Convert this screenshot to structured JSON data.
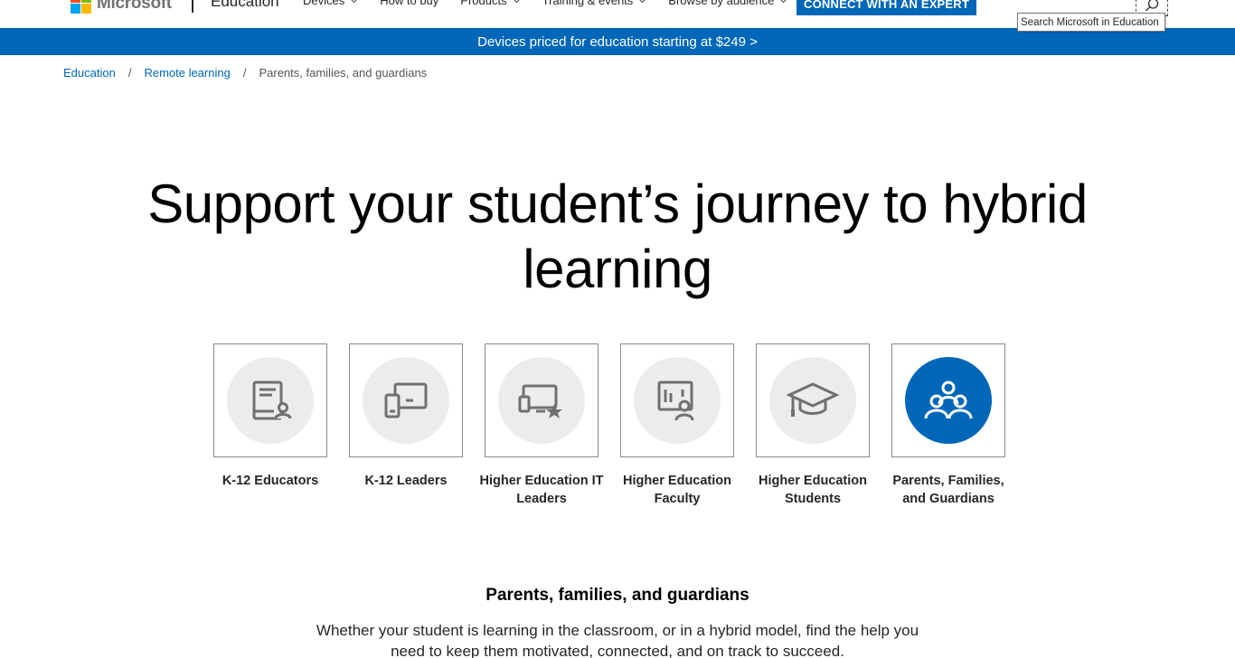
{
  "header": {
    "logo_text": "Microsoft",
    "brand": "Education",
    "nav": [
      {
        "label": "Devices",
        "has_dropdown": true
      },
      {
        "label": "How to buy",
        "has_dropdown": false
      },
      {
        "label": "Products",
        "has_dropdown": true
      },
      {
        "label": "Training & events",
        "has_dropdown": true
      },
      {
        "label": "Browse by audience",
        "has_dropdown": true
      }
    ],
    "cta_label": "CONNECT WITH AN EXPERT",
    "search_tooltip": "Search Microsoft in Education"
  },
  "promo": {
    "text": "Devices priced for education starting at $249 >"
  },
  "breadcrumb": {
    "items": [
      "Education",
      "Remote learning"
    ],
    "current": "Parents, families, and guardians",
    "separator": "/"
  },
  "hero": {
    "title": "Support your student’s journey to hybrid learning"
  },
  "audiences": [
    {
      "label": "K-12 Educators",
      "icon": "book-person-icon",
      "active": false
    },
    {
      "label": "K-12 Leaders",
      "icon": "devices-icon",
      "active": false
    },
    {
      "label": "Higher Education IT Leaders",
      "icon": "device-star-icon",
      "active": false
    },
    {
      "label": "Higher Education Faculty",
      "icon": "chart-person-icon",
      "active": false
    },
    {
      "label": "Higher Education Students",
      "icon": "graduation-cap-icon",
      "active": false
    },
    {
      "label": "Parents, Families, and Guardians",
      "icon": "family-icon",
      "active": true
    }
  ],
  "section": {
    "title": "Parents, families, and guardians",
    "body": "Whether your student is learning in the classroom, or in a hybrid model, find the help you need to keep them motivated, connected, and on track to succeed."
  },
  "colors": {
    "accent": "#0067b8",
    "tile_circle": "#ececec",
    "icon_gray": "#707070"
  }
}
